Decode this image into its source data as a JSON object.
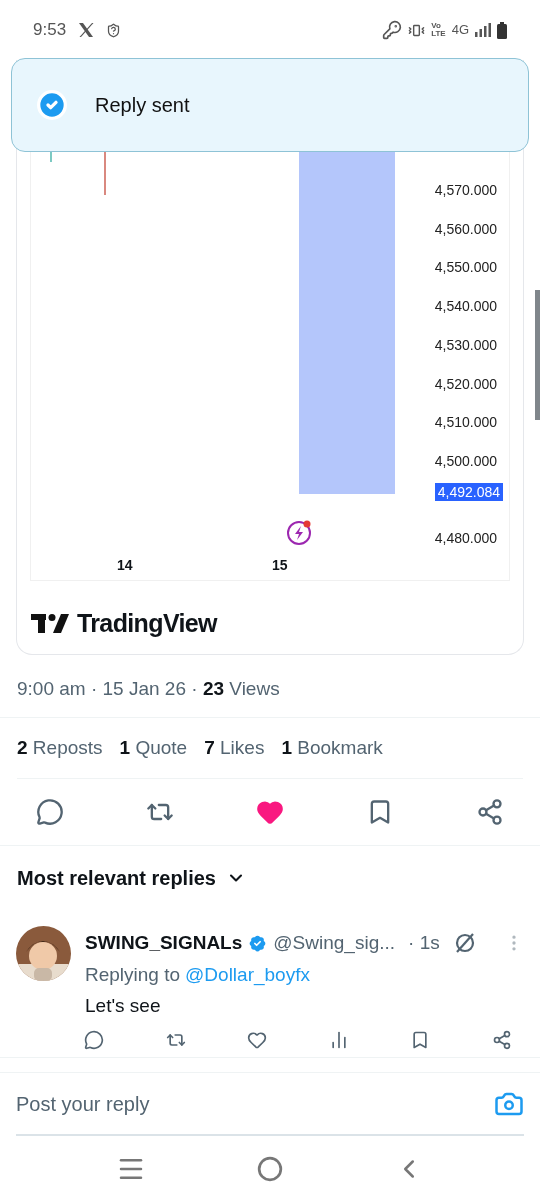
{
  "status_bar": {
    "time": "9:53",
    "network_badge": [
      "Vo",
      "LTE"
    ],
    "network": "4G"
  },
  "toast": {
    "text": "Reply sent",
    "kind": "success"
  },
  "chart": {
    "price_labels": [
      "4,570.000",
      "4,560.000",
      "4,550.000",
      "4,540.000",
      "4,530.000",
      "4,520.000",
      "4,510.000",
      "4,500.000",
      "4,480.000"
    ],
    "current_price": "4,492.084",
    "x_labels": [
      "14",
      "15"
    ],
    "brand": "TradingView"
  },
  "meta": "9:00 am · 15 Jan 26 · **23** Views",
  "stats": [
    "**2** Reposts",
    "**1** Quote",
    "**7** Likes",
    "**1** Bookmark"
  ],
  "actions": [
    {
      "kind": "reply",
      "active": false
    },
    {
      "kind": "repost",
      "active": false
    },
    {
      "kind": "like",
      "active": true
    },
    {
      "kind": "bookmark",
      "active": false
    },
    {
      "kind": "share",
      "active": false
    }
  ],
  "replies_sort": "Most relevant replies",
  "reply": {
    "name": "SWING_SIGNALs",
    "verified": true,
    "handle": "@Swing_sig...",
    "time": "· 1s",
    "replying_label": "Replying to",
    "replying_handle": "@Dollar_boyfx",
    "text": "Let's see",
    "actions": [
      {
        "kind": "reply",
        "active": false
      },
      {
        "kind": "repost",
        "active": false
      },
      {
        "kind": "like",
        "active": false
      },
      {
        "kind": "views",
        "active": false
      },
      {
        "kind": "bookmark",
        "active": false
      },
      {
        "kind": "share",
        "active": false
      }
    ]
  },
  "composer": {
    "placeholder": "Post your reply"
  }
}
